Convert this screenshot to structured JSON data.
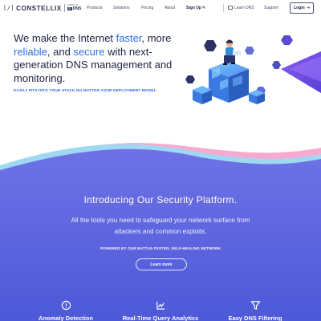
{
  "nav": {
    "logo_mark": "[/]",
    "logo_text": "CONSTELLIX",
    "partner_small": "A PART OF",
    "partner_brand": "DNS",
    "links": [
      "Products",
      "Solutions",
      "Pricing",
      "About"
    ],
    "signup": "Sign Up",
    "learn_dns": "Learn DNS",
    "support": "Support",
    "login": "Login"
  },
  "hero": {
    "title_part1": "We make the Internet ",
    "accent_faster": "faster",
    "title_part2": ", more ",
    "accent_reliable": "reliable",
    "title_part3": ", and ",
    "accent_secure": "secure",
    "title_part4": " with next-generation DNS management and monitoring.",
    "subtitle": "EASILY FITS INTO YOUR STACK NO MATTER YOUR DEPLOYMENT MODEL"
  },
  "section": {
    "title": "Introducing Our Security Platform.",
    "description": "All the tools you need to safeguard your network surface from attackers and common exploits.",
    "powered_by": "POWERED BY OUR BATTLE-TESTED, SELF-HEALING NETWORK",
    "button": "Learn more"
  },
  "features": [
    {
      "label": "Anomaly Detection",
      "icon": "clock-alert-icon"
    },
    {
      "label": "Real-Time Query Analytics",
      "icon": "chart-line-icon"
    },
    {
      "label": "Easy DNS Filtering",
      "icon": "funnel-icon"
    }
  ],
  "colors": {
    "accent": "#2f6de0",
    "dark_text": "#1c2240",
    "gradient_top": "#6f72e6",
    "gradient_bottom": "#4d59d8"
  }
}
